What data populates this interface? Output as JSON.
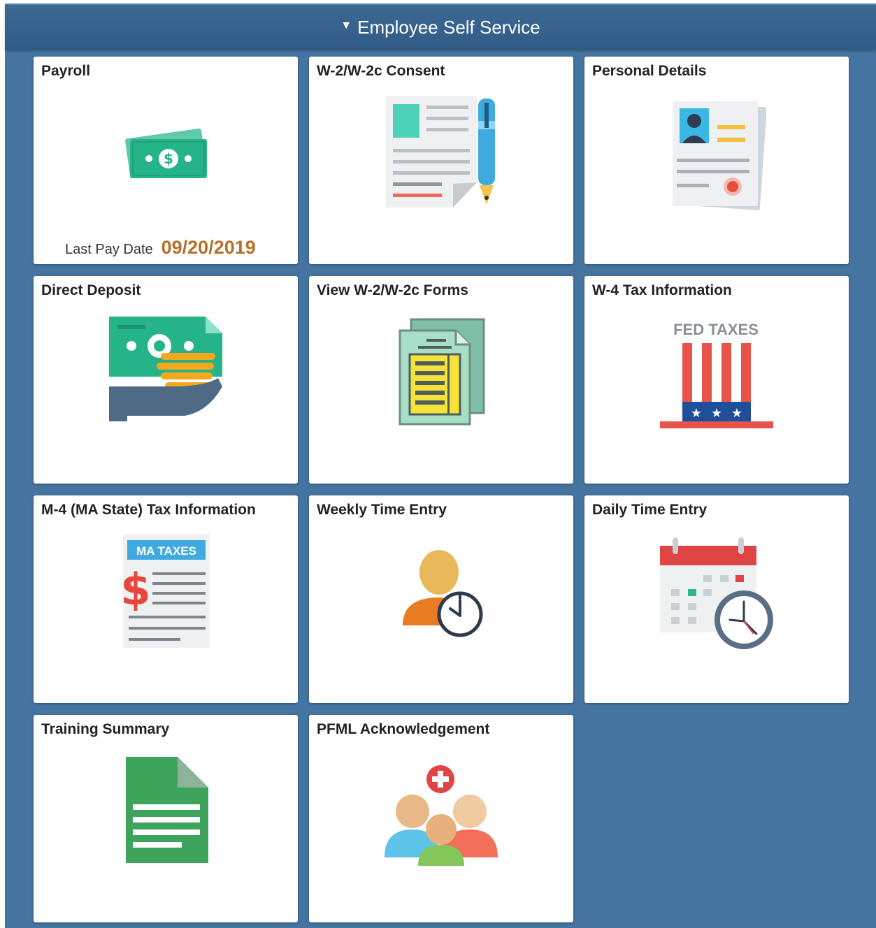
{
  "header": {
    "title": "Employee Self Service",
    "toggle_icon": "triangle-down-icon"
  },
  "tiles": {
    "payroll": {
      "label": "Payroll",
      "icon": "money-icon",
      "last_pay_label": "Last Pay Date",
      "last_pay_value": "09/20/2019"
    },
    "w2_consent": {
      "label": "W-2/W-2c Consent",
      "icon": "document-pen-icon"
    },
    "personal_details": {
      "label": "Personal Details",
      "icon": "id-document-icon"
    },
    "direct_deposit": {
      "label": "Direct Deposit",
      "icon": "hand-money-icon"
    },
    "view_w2": {
      "label": "View W-2/W-2c Forms",
      "icon": "forms-icon"
    },
    "w4": {
      "label": "W-4 Tax Information",
      "icon": "fed-taxes-hat-icon",
      "icon_text": "FED TAXES"
    },
    "m4": {
      "label": "M-4 (MA State) Tax Information",
      "icon": "ma-taxes-document-icon",
      "icon_text": "MA TAXES"
    },
    "weekly_time": {
      "label": "Weekly Time Entry",
      "icon": "person-clock-icon"
    },
    "daily_time": {
      "label": "Daily Time Entry",
      "icon": "calendar-clock-icon"
    },
    "training": {
      "label": "Training Summary",
      "icon": "green-document-icon"
    },
    "pfml": {
      "label": "PFML Acknowledgement",
      "icon": "family-medical-icon"
    }
  },
  "colors": {
    "background": "#44749f",
    "header": "#34608b",
    "date_accent": "#b5702a"
  }
}
